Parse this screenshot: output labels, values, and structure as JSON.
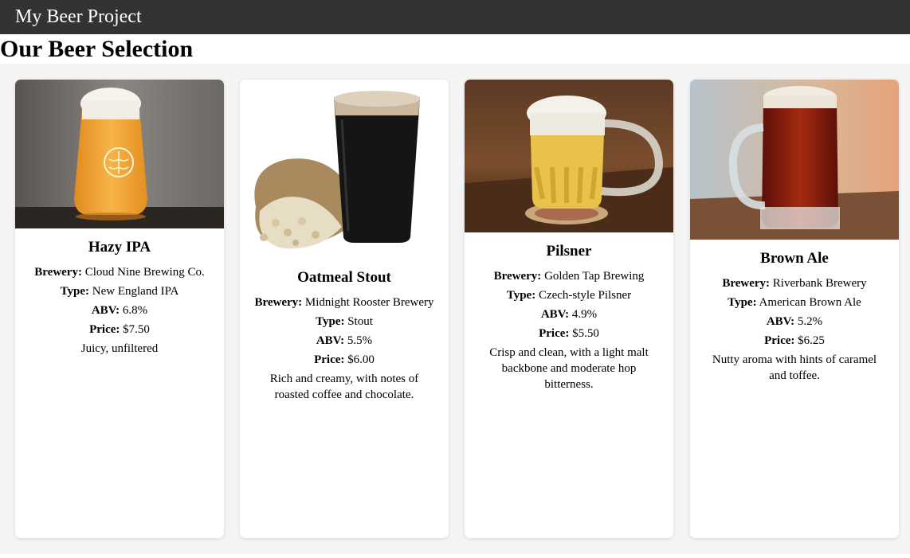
{
  "header": {
    "title": "My Beer Project"
  },
  "page": {
    "heading": "Our Beer Selection"
  },
  "labels": {
    "brewery": "Brewery:",
    "type": "Type:",
    "abv": "ABV:",
    "price": "Price:"
  },
  "beers": [
    {
      "name": "Hazy IPA",
      "brewery": "Cloud Nine Brewing Co.",
      "type": "New England IPA",
      "abv": "6.8%",
      "price": "$7.50",
      "description": "Juicy, unfiltered",
      "image_icon": "hazy-ipa-glass-photo"
    },
    {
      "name": "Oatmeal Stout",
      "brewery": "Midnight Rooster Brewery",
      "type": "Stout",
      "abv": "5.5%",
      "price": "$6.00",
      "description": "Rich and creamy, with notes of roasted coffee and chocolate.",
      "image_icon": "stout-pint-with-oats-photo"
    },
    {
      "name": "Pilsner",
      "brewery": "Golden Tap Brewing",
      "type": "Czech-style Pilsner",
      "abv": "4.9%",
      "price": "$5.50",
      "description": "Crisp and clean, with a light malt backbone and moderate hop bitterness.",
      "image_icon": "pilsner-mug-photo"
    },
    {
      "name": "Brown Ale",
      "brewery": "Riverbank Brewery",
      "type": "American Brown Ale",
      "abv": "5.2%",
      "price": "$6.25",
      "description": "Nutty aroma with hints of caramel and toffee.",
      "image_icon": "brown-ale-mug-photo"
    }
  ],
  "colors": {
    "header_bg": "#333333",
    "page_bg": "#f4f4f4",
    "card_bg": "#ffffff"
  }
}
